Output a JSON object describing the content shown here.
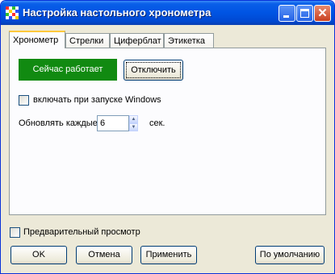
{
  "window": {
    "title": "Настройка настольного хронометра",
    "icon": "app-grid-icon",
    "controls": [
      "minimize-icon",
      "maximize-icon",
      "close-icon"
    ],
    "accent_color": "#0054e3"
  },
  "tabs": [
    {
      "label": "Хронометр",
      "active": true
    },
    {
      "label": "Стрелки",
      "active": false
    },
    {
      "label": "Циферблат",
      "active": false
    },
    {
      "label": "Этикетка",
      "active": false
    }
  ],
  "chronometer_tab": {
    "status_label": "Сейчас работает",
    "status_color": "#118a11",
    "toggle_button": "Отключить",
    "startup_checkbox": {
      "label": "включать при запуске Windows",
      "checked": false
    },
    "refresh": {
      "label": "Обновлять каждые:",
      "value": "6",
      "unit": "сек."
    }
  },
  "preview_checkbox": {
    "label": "Предварительный просмотр",
    "checked": false
  },
  "buttons": {
    "ok": "OK",
    "cancel": "Отмена",
    "apply": "Применить",
    "defaults": "По умолчанию"
  }
}
